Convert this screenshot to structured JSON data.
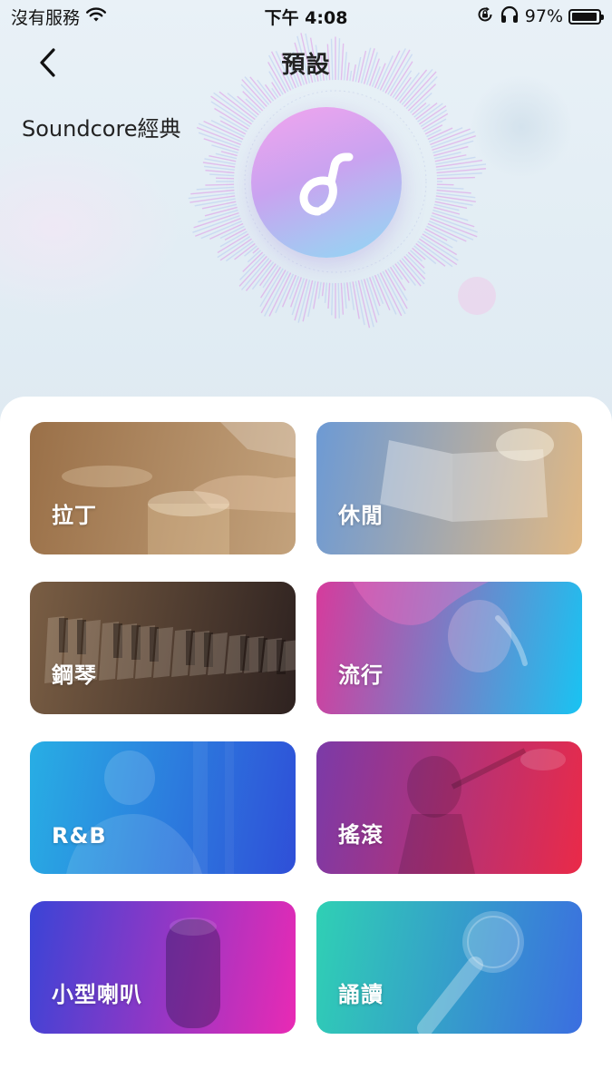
{
  "status_bar": {
    "carrier": "沒有服務",
    "time": "下午 4:08",
    "battery_percent": "97%",
    "battery_level": 0.97,
    "icons": [
      "wifi-icon",
      "orientation-lock-icon",
      "headphones-icon",
      "battery-icon"
    ]
  },
  "nav": {
    "title": "預設",
    "back_icon": "chevron-left-icon"
  },
  "preset": {
    "name": "Soundcore經典",
    "logo_icon": "soundcore-note-icon"
  },
  "cards": [
    {
      "label": "拉丁",
      "gradient": [
        "#9a7048",
        "#c3a27c"
      ]
    },
    {
      "label": "休閒",
      "gradient": [
        "#6d9ad4",
        "#e0b884"
      ]
    },
    {
      "label": "鋼琴",
      "gradient": [
        "#7a5e44",
        "#2e2220"
      ]
    },
    {
      "label": "流行",
      "gradient": [
        "#d63b9c",
        "#19c3f2"
      ]
    },
    {
      "label": "R&B",
      "gradient": [
        "#28aee4",
        "#2f4fd8"
      ]
    },
    {
      "label": "搖滾",
      "gradient": [
        "#7b3aa8",
        "#ea2a48"
      ]
    },
    {
      "label": "小型喇叭",
      "gradient": [
        "#3a44d6",
        "#e92ab4"
      ]
    },
    {
      "label": "誦讀",
      "gradient": [
        "#2fd0b4",
        "#3b6ee0"
      ]
    }
  ]
}
